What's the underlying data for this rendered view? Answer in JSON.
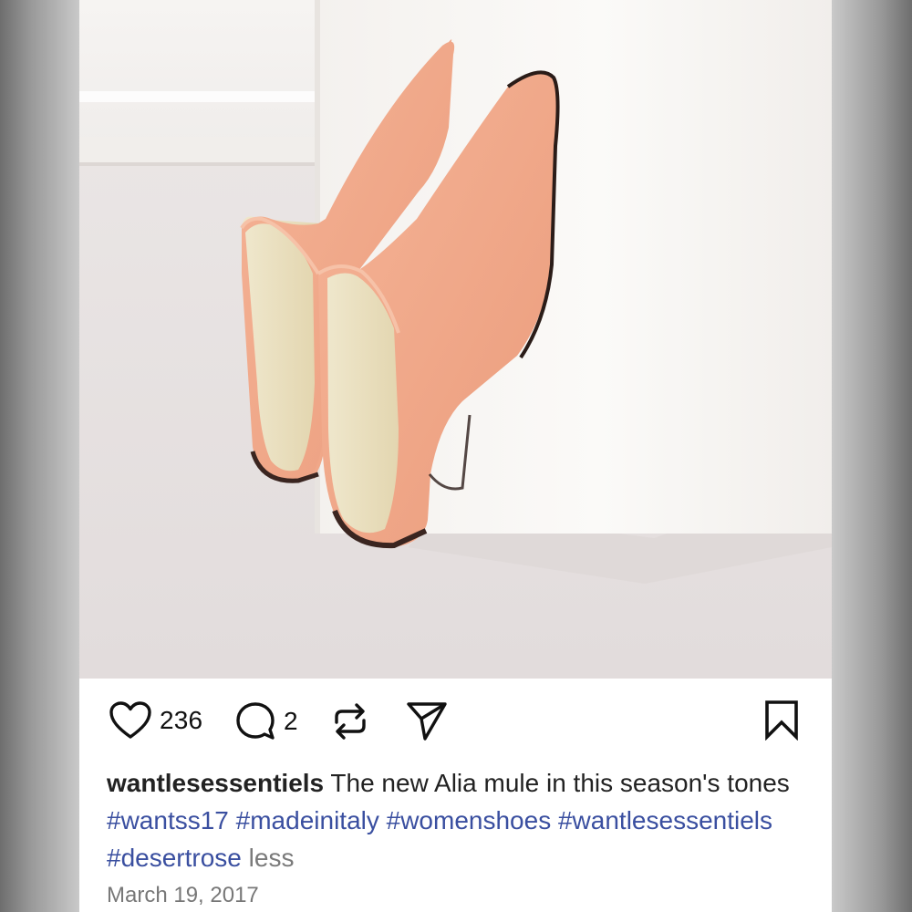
{
  "post": {
    "photo_alt": "Peach suede mules leaning against a white block",
    "likes": "236",
    "comments": "2",
    "username": "wantlesessentiels",
    "caption_text": "The new Alia mule in this season's tones",
    "hashtags": [
      "#wantss17",
      "#madeinitaly",
      "#womenshoes",
      "#wantlesessentiels",
      "#desertrose"
    ],
    "more_label": "less",
    "date": "March 19, 2017"
  },
  "icons": {
    "like": "heart-icon",
    "comment": "comment-bubble-icon",
    "repost": "repost-arrows-icon",
    "share": "send-paper-plane-icon",
    "save": "bookmark-icon"
  },
  "colors": {
    "hashtag": "#3a4fa0",
    "shoe": "#f0a88a",
    "background": "#ebe7e6"
  }
}
